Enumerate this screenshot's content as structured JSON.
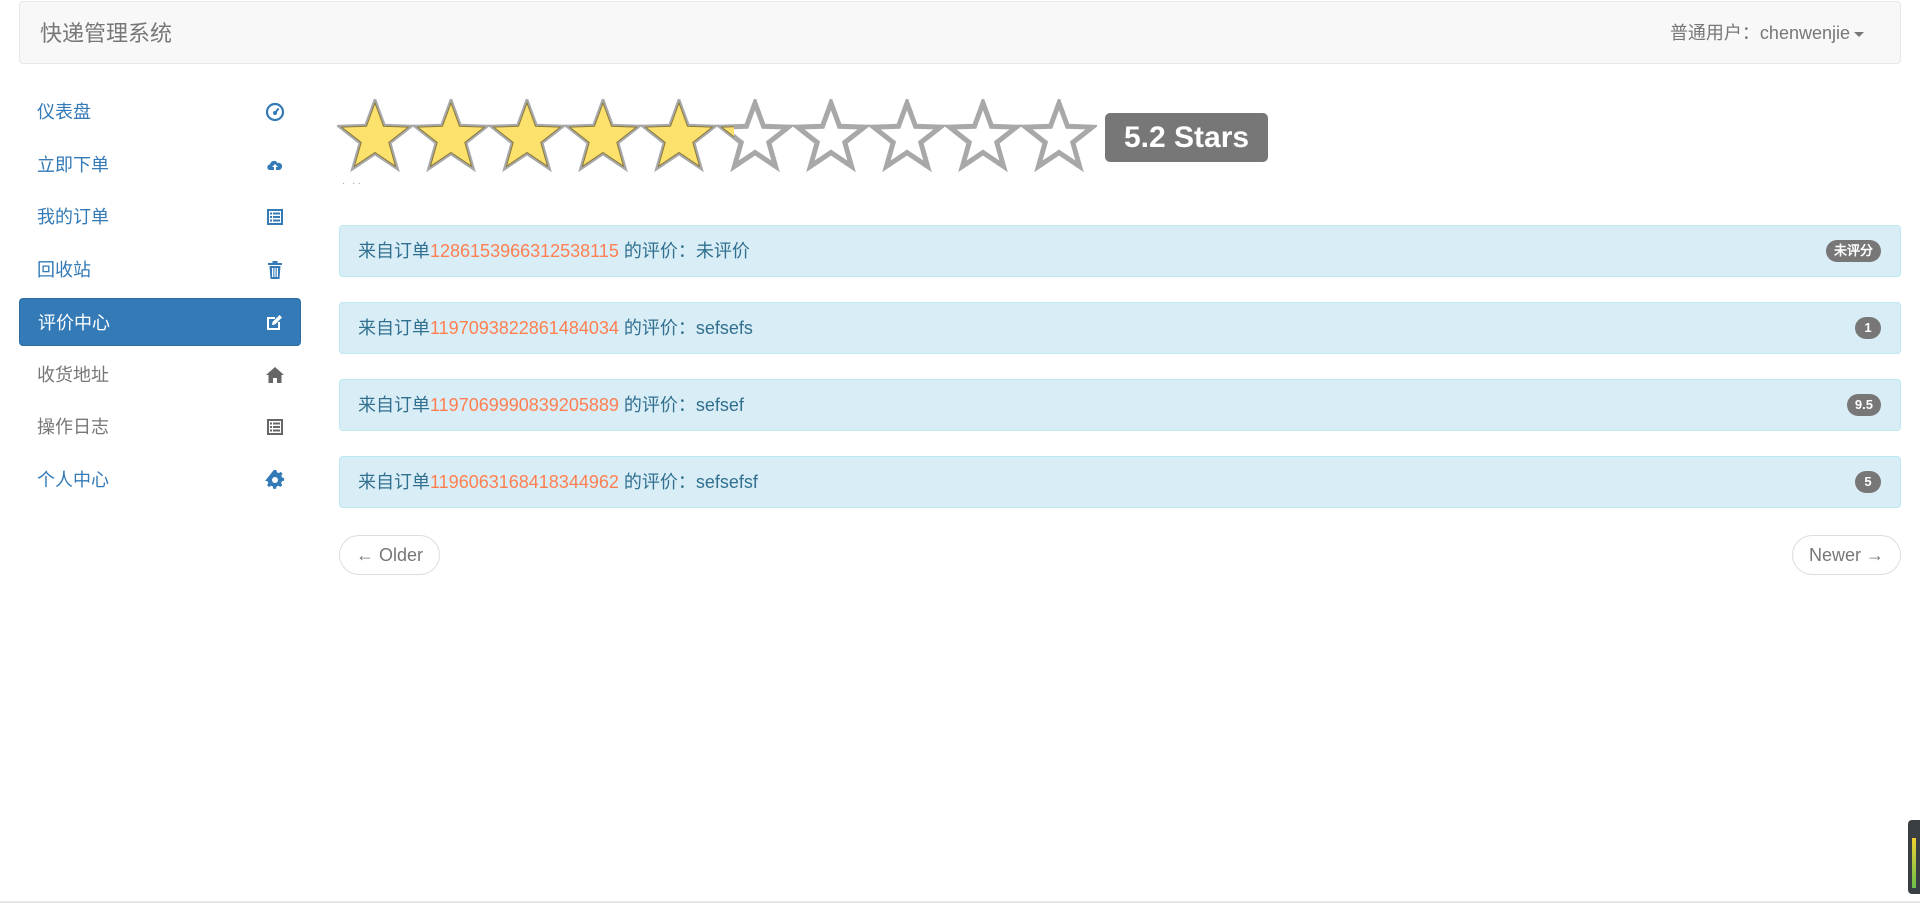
{
  "navbar": {
    "brand": "快递管理系统",
    "user_label": "普通用户：chenwenjie"
  },
  "sidebar": {
    "items": [
      {
        "label": "仪表盘",
        "icon": "dashboard-icon",
        "state": "link"
      },
      {
        "label": "立即下单",
        "icon": "cloud-upload-icon",
        "state": "link"
      },
      {
        "label": "我的订单",
        "icon": "list-alt-icon",
        "state": "link"
      },
      {
        "label": "回收站",
        "icon": "trash-icon",
        "state": "link"
      },
      {
        "label": "评价中心",
        "icon": "edit-icon",
        "state": "active"
      },
      {
        "label": "收货地址",
        "icon": "home-icon",
        "state": "muted"
      },
      {
        "label": "操作日志",
        "icon": "list-alt-icon",
        "state": "muted"
      },
      {
        "label": "个人中心",
        "icon": "cog-icon",
        "state": "link"
      }
    ]
  },
  "rating": {
    "value": 5.2,
    "max": 10,
    "badge": "5.2 Stars",
    "caption": "· ··",
    "filled_color": "#fde16d",
    "empty_color": "#a8a8a8"
  },
  "comments": [
    {
      "prefix": "来自订单",
      "order_no": "1286153966312538115",
      "suffix": " 的评价：未评价",
      "score": "未评分"
    },
    {
      "prefix": "来自订单",
      "order_no": "1197093822861484034",
      "suffix": " 的评价：sefsefs",
      "score": "1"
    },
    {
      "prefix": "来自订单",
      "order_no": "1197069990839205889",
      "suffix": " 的评价：sefsef",
      "score": "9.5"
    },
    {
      "prefix": "来自订单",
      "order_no": "1196063168418344962",
      "suffix": " 的评价：sefsefsf",
      "score": "5"
    }
  ],
  "pager": {
    "older": "← Older",
    "newer": "Newer →"
  },
  "colors": {
    "primary": "#337ab7",
    "alert_bg": "#d9edf7",
    "order_no": "#ff7f50",
    "badge": "#777777"
  }
}
